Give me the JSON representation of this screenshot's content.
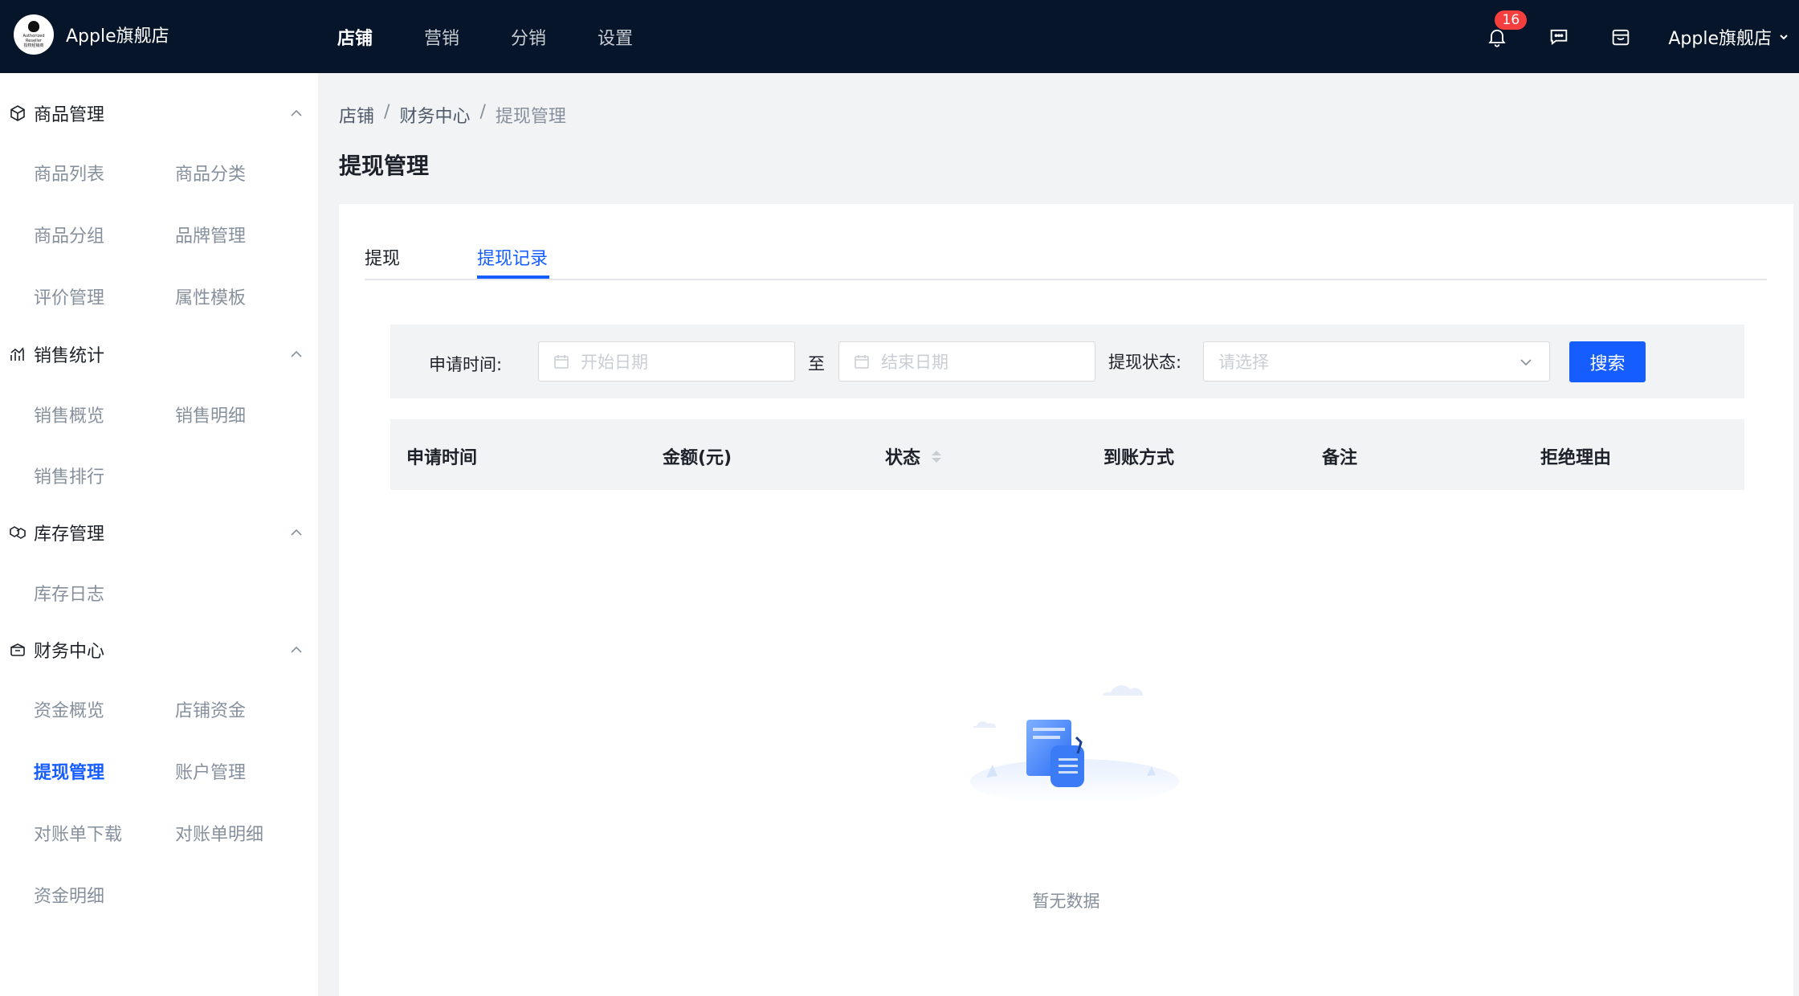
{
  "header": {
    "store_name": "Apple旗舰店",
    "logo_text": [
      "Authorized",
      "Reseller",
      "授权经销商"
    ],
    "nav": [
      "店铺",
      "营销",
      "分销",
      "设置"
    ],
    "notification_count": "16",
    "user_name": "Apple旗舰店"
  },
  "sidebar": {
    "groups": [
      {
        "title": "商品管理",
        "icon": "cube-icon",
        "items": [
          "商品列表",
          "商品分类",
          "商品分组",
          "品牌管理",
          "评价管理",
          "属性模板"
        ]
      },
      {
        "title": "销售统计",
        "icon": "chart-icon",
        "items": [
          "销售概览",
          "销售明细",
          "销售排行"
        ]
      },
      {
        "title": "库存管理",
        "icon": "boxes-icon",
        "items": [
          "库存日志"
        ]
      },
      {
        "title": "财务中心",
        "icon": "wallet-icon",
        "items": [
          "资金概览",
          "店铺资金",
          "提现管理",
          "账户管理",
          "对账单下载",
          "对账单明细",
          "资金明细"
        ]
      }
    ],
    "active_item": "提现管理"
  },
  "breadcrumb": [
    "店铺",
    "财务中心",
    "提现管理"
  ],
  "breadcrumb_sep": "/",
  "page_title": "提现管理",
  "tabs": [
    "提现",
    "提现记录"
  ],
  "active_tab": "提现记录",
  "filter": {
    "time_label": "申请时间:",
    "start_placeholder": "开始日期",
    "to_text": "至",
    "end_placeholder": "结束日期",
    "status_label": "提现状态:",
    "status_placeholder": "请选择",
    "search_button": "搜索"
  },
  "table": {
    "columns": [
      "申请时间",
      "金额(元)",
      "状态",
      "到账方式",
      "备注",
      "拒绝理由"
    ]
  },
  "empty_text": "暂无数据",
  "colors": {
    "topbar": "#061529",
    "primary": "#165dff",
    "badge": "#f53f3f"
  }
}
